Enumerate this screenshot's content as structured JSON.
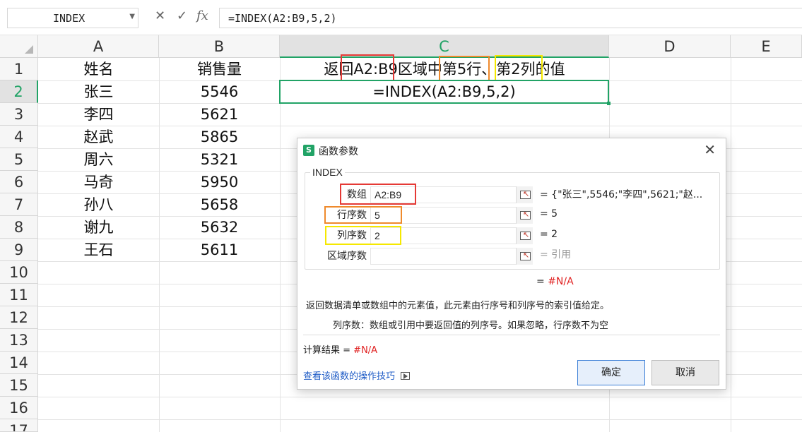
{
  "formula_bar": {
    "name_box": "INDEX",
    "cancel_icon": "✕",
    "enter_icon": "✓",
    "fx_label": "fx",
    "formula": "=INDEX(A2:B9,5,2)"
  },
  "columns": [
    "A",
    "B",
    "C",
    "D",
    "E"
  ],
  "rows": [
    "1",
    "2",
    "3",
    "4",
    "5",
    "6",
    "7",
    "8",
    "9",
    "10",
    "11",
    "12",
    "13",
    "14",
    "15",
    "16",
    "17"
  ],
  "table": {
    "header_name": "姓名",
    "header_sales": "销售量",
    "records": [
      {
        "name": "张三",
        "sales": "5546"
      },
      {
        "name": "李四",
        "sales": "5621"
      },
      {
        "name": "赵武",
        "sales": "5865"
      },
      {
        "name": "周六",
        "sales": "5321"
      },
      {
        "name": "马奇",
        "sales": "5950"
      },
      {
        "name": "孙八",
        "sales": "5658"
      },
      {
        "name": "谢九",
        "sales": "5632"
      },
      {
        "name": "王石",
        "sales": "5611"
      }
    ]
  },
  "c1": {
    "p1": "返回",
    "range": "A2:B9",
    "p2": "区域中",
    "row": "第5行、",
    "col": "第2列",
    "p3": "的值"
  },
  "c2_formula": "=INDEX(A2:B9,5,2)",
  "highlight_colors": {
    "range": "#e53935",
    "row": "#ef8a2c",
    "col": "#f5e800"
  },
  "dialog": {
    "title": "函数参数",
    "function_name": "INDEX",
    "args": [
      {
        "label": "数组",
        "value": "A2:B9",
        "result": "= {\"张三\",5546;\"李四\",5621;\"赵..."
      },
      {
        "label": "行序数",
        "value": "5",
        "result": "= 5"
      },
      {
        "label": "列序数",
        "value": "2",
        "result": "= 2"
      },
      {
        "label": "区域序数",
        "value": "",
        "result": "= 引用"
      }
    ],
    "result_prefix": "=",
    "result_value": "#N/A",
    "description": "返回数据清单或数组中的元素值，此元素由行序号和列序号的索引值给定。",
    "arg_help": "列序数：数组或引用中要返回值的列序号。如果忽略，行序数不为空",
    "calc_label": "计算结果 =",
    "calc_value": "#N/A",
    "help_link": "查看该函数的操作技巧",
    "ok": "确定",
    "cancel": "取消"
  }
}
